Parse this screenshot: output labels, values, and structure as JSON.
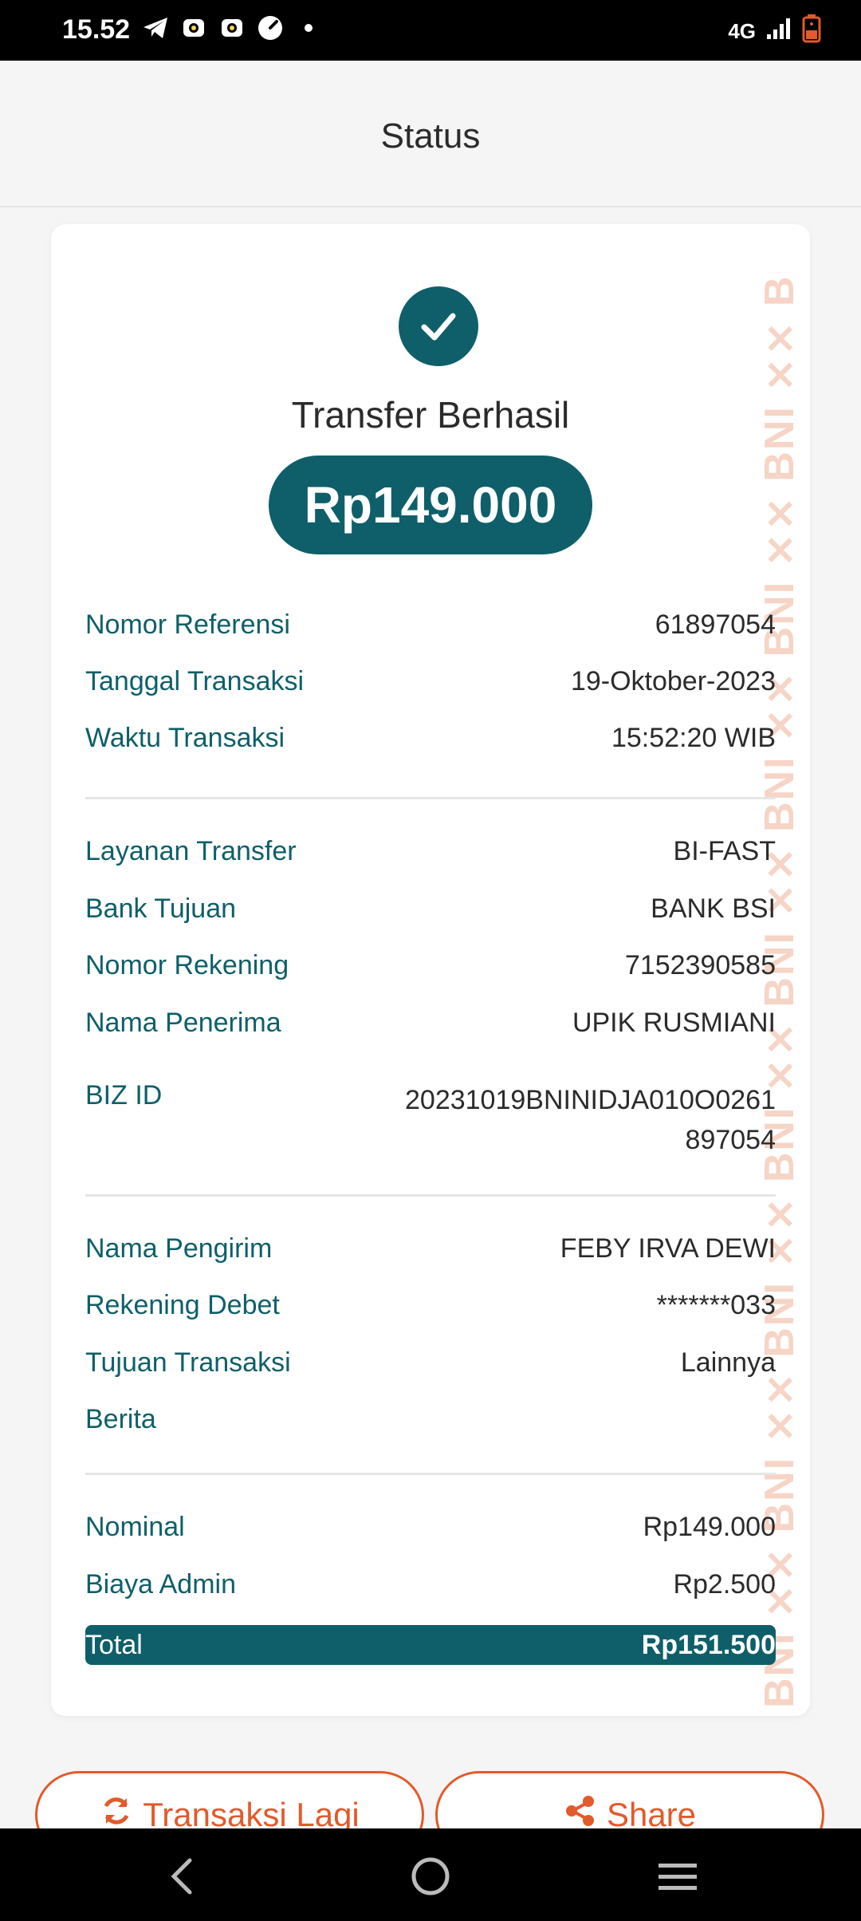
{
  "status_bar": {
    "time": "15.52",
    "network": "4G"
  },
  "header": {
    "title": "Status"
  },
  "result": {
    "title": "Transfer Berhasil",
    "amount": "Rp149.000"
  },
  "section1": [
    {
      "label": "Nomor Referensi",
      "value": "61897054"
    },
    {
      "label": "Tanggal Transaksi",
      "value": "19-Oktober-2023"
    },
    {
      "label": "Waktu Transaksi",
      "value": "15:52:20 WIB"
    }
  ],
  "section2": [
    {
      "label": "Layanan Transfer",
      "value": "BI-FAST"
    },
    {
      "label": "Bank Tujuan",
      "value": "BANK BSI"
    },
    {
      "label": "Nomor Rekening",
      "value": "7152390585"
    },
    {
      "label": "Nama Penerima",
      "value": "UPIK RUSMIANI"
    },
    {
      "label": "BIZ ID",
      "value": "20231019BNINIDJA010O0261897054"
    }
  ],
  "section3": [
    {
      "label": "Nama Pengirim",
      "value": "FEBY IRVA DEWI"
    },
    {
      "label": "Rekening Debet",
      "value": "*******033"
    },
    {
      "label": "Tujuan Transaksi",
      "value": "Lainnya"
    },
    {
      "label": "Berita",
      "value": ""
    }
  ],
  "section4": [
    {
      "label": "Nominal",
      "value": "Rp149.000"
    },
    {
      "label": "Biaya Admin",
      "value": "Rp2.500"
    }
  ],
  "total": {
    "label": "Total",
    "value": "Rp151.500"
  },
  "buttons": {
    "again_label": "Transaksi Lagi",
    "share_label": "Share"
  },
  "watermark": "BNI",
  "colors": {
    "primary": "#0e5f6a",
    "accent": "#e35a2b",
    "watermark": "#f4c6b3"
  },
  "icons": [
    "telegram-icon",
    "app-icon",
    "app-icon",
    "speed-icon",
    "signal-icon",
    "battery-icon",
    "check-icon",
    "refresh-icon",
    "share-icon",
    "back-icon",
    "home-icon",
    "menu-icon"
  ]
}
